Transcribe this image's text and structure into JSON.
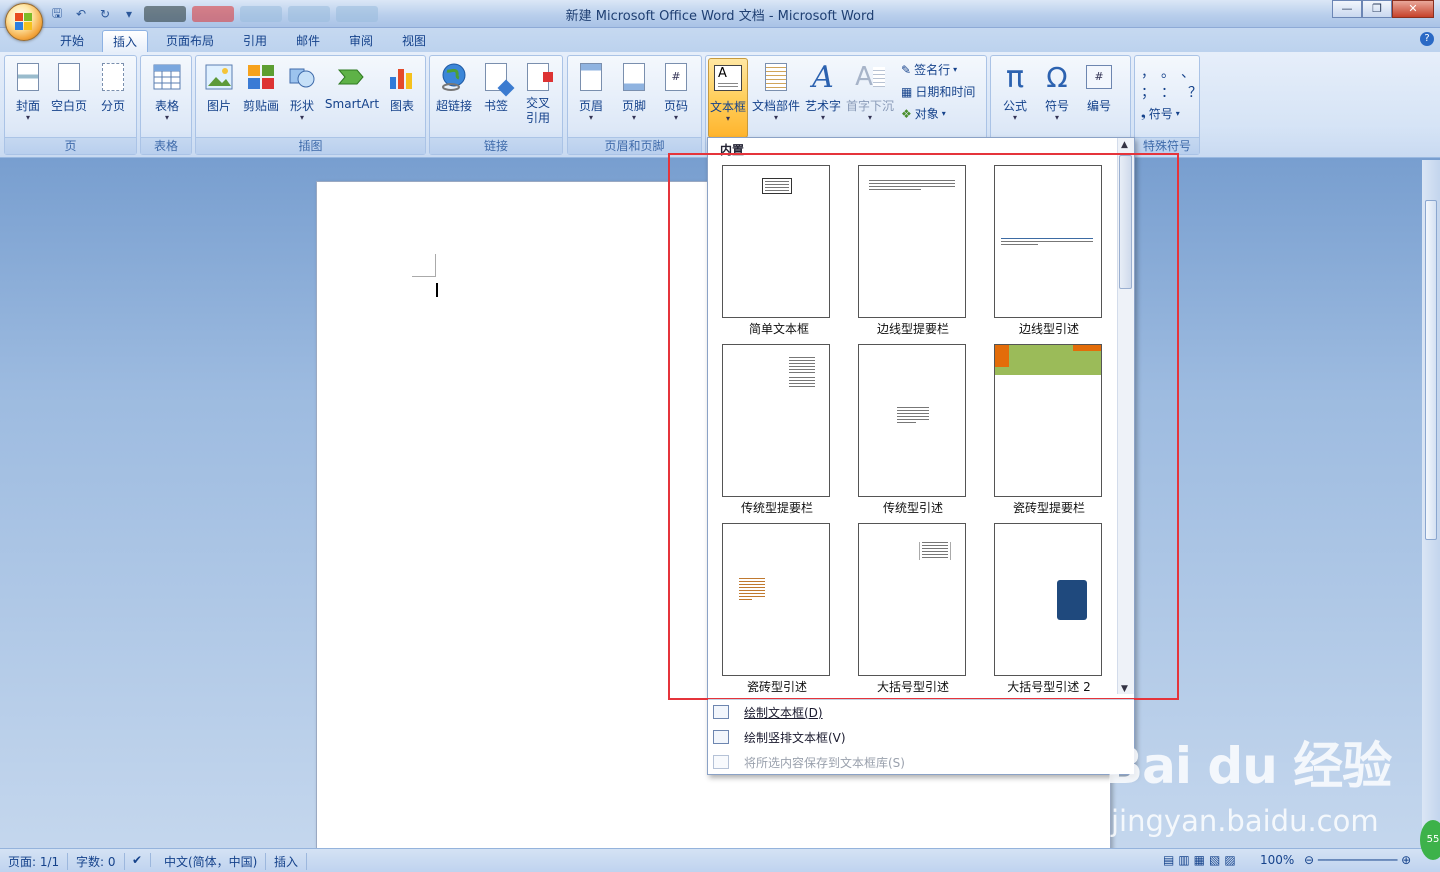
{
  "app": {
    "title": "新建 Microsoft Office Word 文档 - Microsoft Word"
  },
  "tabs": [
    {
      "label": "开始"
    },
    {
      "label": "插入"
    },
    {
      "label": "页面布局"
    },
    {
      "label": "引用"
    },
    {
      "label": "邮件"
    },
    {
      "label": "审阅"
    },
    {
      "label": "视图"
    }
  ],
  "groups": {
    "page": {
      "label": "页",
      "buttons": [
        "封面",
        "空白页",
        "分页"
      ]
    },
    "table": {
      "label": "表格",
      "buttons": [
        "表格"
      ]
    },
    "illustrations": {
      "label": "插图",
      "buttons": [
        "图片",
        "剪贴画",
        "形状",
        "SmartArt",
        "图表"
      ]
    },
    "links": {
      "label": "链接",
      "buttons": [
        "超链接",
        "书签",
        "交叉\n引用"
      ]
    },
    "headerfooter": {
      "label": "页眉和页脚",
      "buttons": [
        "页眉",
        "页脚",
        "页码"
      ]
    },
    "text": {
      "buttons": [
        "文本框",
        "文档部件",
        "艺术字",
        "首字下沉"
      ],
      "small": [
        "签名行",
        "日期和时间",
        "对象"
      ]
    },
    "symbols": {
      "buttons": [
        "公式",
        "符号",
        "编号"
      ]
    },
    "special": {
      "label": "特殊符号",
      "small": [
        "符号"
      ]
    }
  },
  "gallery": {
    "heading": "内置",
    "items": [
      {
        "label": "简单文本框"
      },
      {
        "label": "边线型提要栏"
      },
      {
        "label": "边线型引述"
      },
      {
        "label": "传统型提要栏"
      },
      {
        "label": "传统型引述"
      },
      {
        "label": "瓷砖型提要栏"
      },
      {
        "label": "瓷砖型引述"
      },
      {
        "label": "大括号型引述"
      },
      {
        "label": "大括号型引述 2"
      }
    ],
    "menu": [
      {
        "label": "绘制文本框(D)",
        "enabled": true
      },
      {
        "label": "绘制竖排文本框(V)",
        "enabled": true
      },
      {
        "label": "将所选内容保存到文本框库(S)",
        "enabled": false
      }
    ]
  },
  "status": {
    "page": "页面: 1/1",
    "words": "字数: 0",
    "lang": "中文(简体，中国)",
    "mode": "插入",
    "zoom": "100%"
  },
  "watermark": {
    "brand": "Bai du 经验",
    "url": "jingyan.baidu.com"
  },
  "badge": "55",
  "colors": {
    "accent": "#ffcf5c",
    "highlight": "#e5343b",
    "ribbon": "#d6e4f6"
  }
}
